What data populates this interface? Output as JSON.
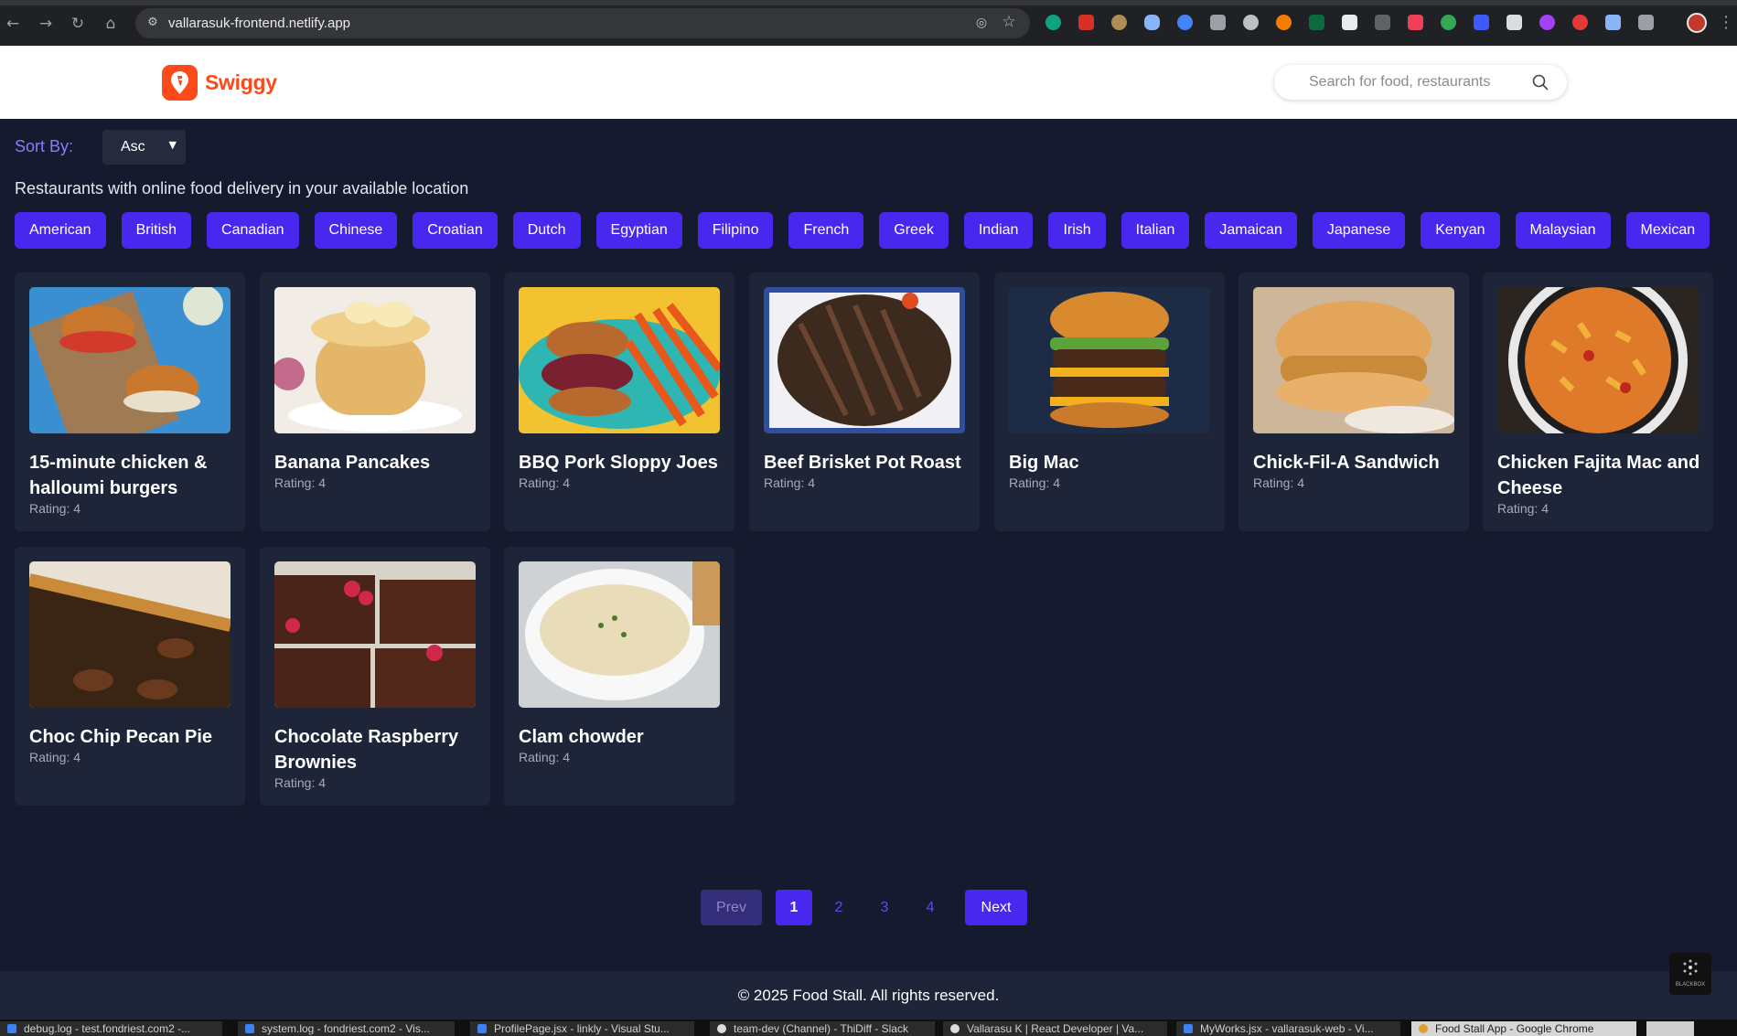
{
  "browser": {
    "url": "vallarasuk-frontend.netlify.app",
    "icons": [
      "back-icon",
      "forward-icon",
      "reload-icon",
      "home-icon",
      "site-settings-icon",
      "eye-off-icon",
      "bookmark-star-icon"
    ]
  },
  "header": {
    "brand": "Swiggy",
    "brand_color": "#fc4a1a",
    "search_placeholder": "Search for food, restaurants"
  },
  "sort": {
    "label": "Sort By:",
    "selected": "Asc"
  },
  "section_title": "Restaurants with online food delivery in your available location",
  "cuisines": [
    "American",
    "British",
    "Canadian",
    "Chinese",
    "Croatian",
    "Dutch",
    "Egyptian",
    "Filipino",
    "French",
    "Greek",
    "Indian",
    "Irish",
    "Italian",
    "Jamaican",
    "Japanese",
    "Kenyan",
    "Malaysian",
    "Mexican"
  ],
  "cards": [
    {
      "title": "15-minute chicken & halloumi burgers",
      "rating": "Rating: 4"
    },
    {
      "title": "Banana Pancakes",
      "rating": "Rating: 4"
    },
    {
      "title": "BBQ Pork Sloppy Joes",
      "rating": "Rating: 4"
    },
    {
      "title": "Beef Brisket Pot Roast",
      "rating": "Rating: 4"
    },
    {
      "title": "Big Mac",
      "rating": "Rating: 4"
    },
    {
      "title": "Chick-Fil-A Sandwich",
      "rating": "Rating: 4"
    },
    {
      "title": "Chicken Fajita Mac and Cheese",
      "rating": "Rating: 4"
    },
    {
      "title": "Choc Chip Pecan Pie",
      "rating": "Rating: 4"
    },
    {
      "title": "Chocolate Raspberry Brownies",
      "rating": "Rating: 4"
    },
    {
      "title": "Clam chowder",
      "rating": "Rating: 4"
    }
  ],
  "pagination": {
    "prev": "Prev",
    "pages": [
      "1",
      "2",
      "3",
      "4"
    ],
    "current": "1",
    "next": "Next"
  },
  "footer": {
    "text": "© 2025 Food Stall. All rights reserved.",
    "badge": "BLACKBOX"
  },
  "taskbar": [
    "debug.log - test.fondriest.com2 -...",
    "system.log - fondriest.com2 - Vis...",
    "ProfilePage.jsx - linkly - Visual Stu...",
    "team-dev (Channel) - ThiDiff - Slack",
    "Vallarasu K | React Developer | Va...",
    "MyWorks.jsx - vallarasuk-web - Vi...",
    "Food Stall App - Google Chrome"
  ],
  "colors": {
    "background": "#161a2e",
    "card": "#1f2538",
    "accent": "#4827ee",
    "sort_label": "#8b7cf8"
  }
}
